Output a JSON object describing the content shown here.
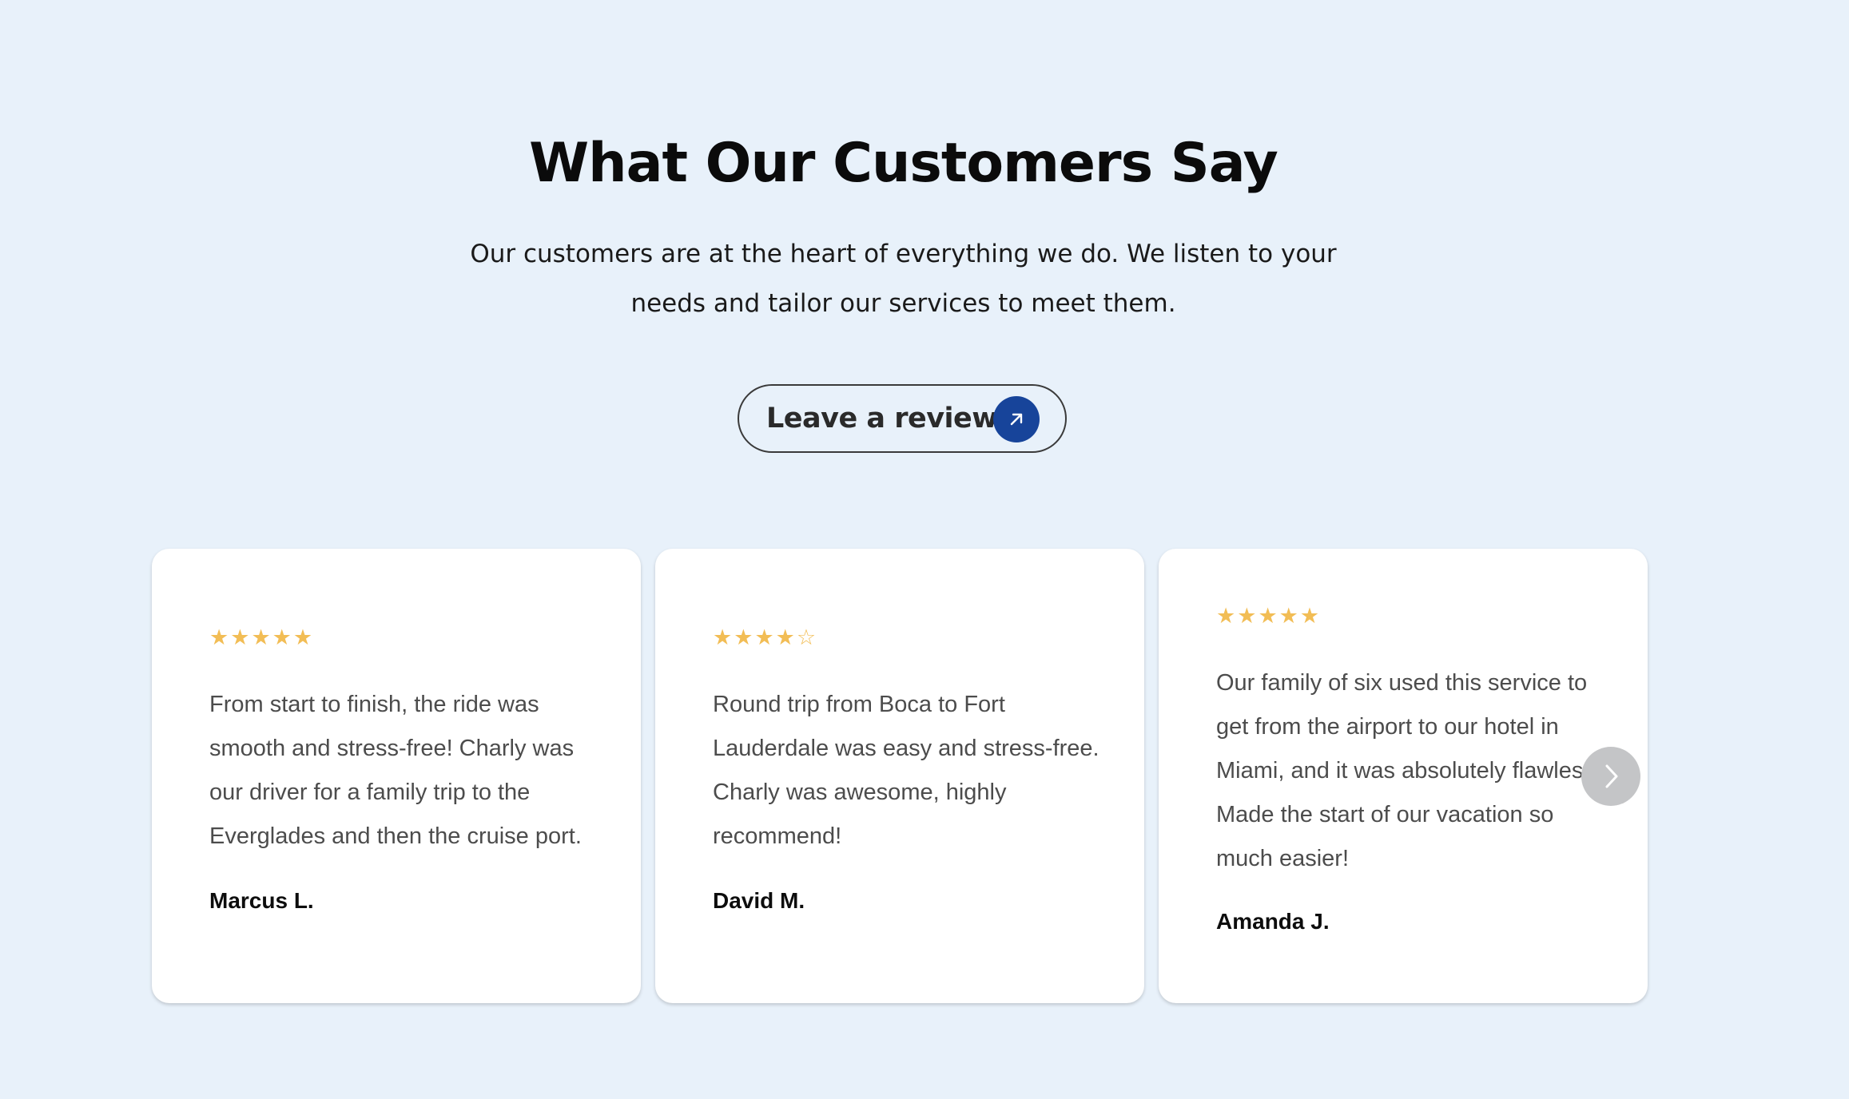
{
  "header": {
    "title": "What Our Customers Say",
    "subtitle_line1": "Our customers are at the heart of everything we do. We listen to your",
    "subtitle_line2": "needs and tailor our services to meet them."
  },
  "cta": {
    "label": "Leave a review!",
    "icon": "arrow-up-right-icon",
    "icon_bg": "#17449a"
  },
  "reviews": [
    {
      "rating": 5,
      "rating_max": 5,
      "text": "From start to finish, the ride was smooth and stress-free! Charly was our driver for a family trip to the Everglades and then the cruise port.",
      "author": "Marcus L."
    },
    {
      "rating": 4,
      "rating_max": 5,
      "text": "Round trip from Boca to Fort Lauderdale was easy and stress-free. Charly was awesome, highly recommend!",
      "author": "David M."
    },
    {
      "rating": 5,
      "rating_max": 5,
      "text": "Our family of six used this service to get from the airport to our hotel in Miami, and it was absolutely flawless. Made the start of our vacation so much easier!",
      "author": "Amanda J."
    }
  ],
  "carousel": {
    "next_icon": "chevron-right-icon"
  },
  "colors": {
    "background": "#e8f1fa",
    "star": "#f2bd55",
    "card": "#ffffff"
  }
}
